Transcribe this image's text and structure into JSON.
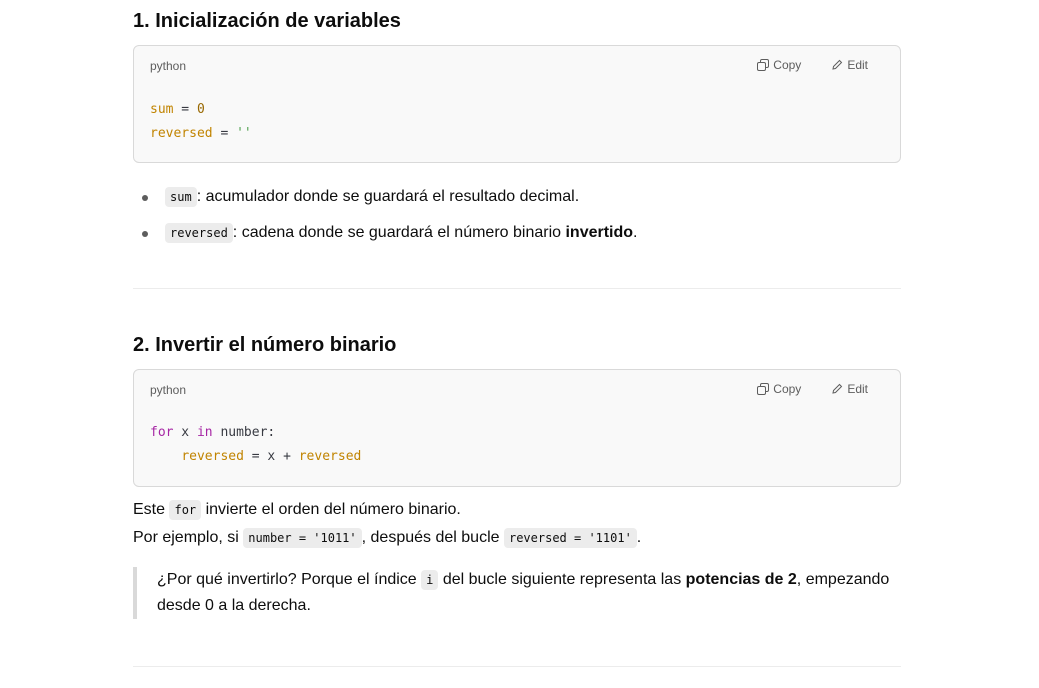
{
  "section1": {
    "heading": "1. Inicialización de variables",
    "code": {
      "lang": "python",
      "copy_label": "Copy",
      "edit_label": "Edit",
      "line1": {
        "var": "sum",
        "op": " = ",
        "val": "0"
      },
      "line2": {
        "var": "reversed",
        "op": " = ",
        "val": "''"
      }
    },
    "bullets": [
      {
        "code": "sum",
        "text": ": acumulador donde se guardará el resultado decimal."
      },
      {
        "code": "reversed",
        "text_before": ": cadena donde se guardará el número binario ",
        "bold": "invertido",
        "text_after": "."
      }
    ]
  },
  "section2": {
    "heading": "2. Invertir el número binario",
    "code": {
      "lang": "python",
      "copy_label": "Copy",
      "edit_label": "Edit",
      "line1": {
        "kw1": "for",
        "sp1": " x ",
        "kw2": "in",
        "rest": " number:"
      },
      "line2": {
        "indent": "    ",
        "var1": "reversed",
        "mid": " = x + ",
        "var2": "reversed"
      }
    },
    "para1": {
      "before": "Este ",
      "code": "for",
      "after": " invierte el orden del número binario."
    },
    "para2": {
      "before": "Por ejemplo, si ",
      "code1": "number = '1011'",
      "mid": ", después del bucle ",
      "code2": "reversed = '1101'",
      "after": "."
    },
    "quote": {
      "before": "¿Por qué invertirlo? Porque el índice ",
      "code": "i",
      "mid": " del bucle siguiente representa las ",
      "bold": "potencias de 2",
      "after": ", empezando desde 0 a la derecha."
    }
  }
}
